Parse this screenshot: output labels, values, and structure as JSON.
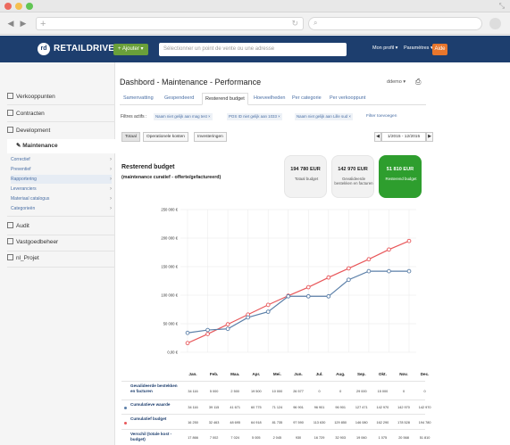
{
  "browser": {
    "add_tab": "+",
    "back": "◀",
    "forward": "▶",
    "reload": "↻",
    "search": "⌕"
  },
  "header": {
    "logo_text": "RETAILDRIVE",
    "logo_mark": "rd",
    "add_button": "+ Ajouter ▾",
    "select_placeholder": "Sélectionner un point de vente ou une adresse",
    "profile_menu": "Mon profil ▾",
    "settings_menu": "Paramètres ▾",
    "help_button": "Aide",
    "brand_color": "#1d3e6e",
    "add_color": "#6aa03a",
    "help_color": "#e8762c"
  },
  "sidebar": {
    "items": [
      {
        "label": "Verkooppunten",
        "icon": "store-icon"
      },
      {
        "label": "Contracten",
        "icon": "contract-icon"
      },
      {
        "label": "Development",
        "icon": "development-icon"
      },
      {
        "label": "Maintenance",
        "icon": "wrench-icon"
      },
      {
        "label": "Audit",
        "icon": "audit-icon"
      },
      {
        "label": "Vastgoedbeheer",
        "icon": "building-icon"
      },
      {
        "label": "nl_Projet",
        "icon": "project-icon"
      }
    ],
    "sub_items": [
      "Correctief",
      "Preventief",
      "Rapportering",
      "Leveranciers",
      "Materiaal catalogus",
      "Categorieën"
    ]
  },
  "main": {
    "title": "Dashbord - Maintenance - Performance",
    "user_menu": "ddemo ▾",
    "print_icon": "⎙",
    "tabs": [
      "Samenvatting",
      "Gespendeerd",
      "Resterend budget",
      "Hoeveelheden",
      "Per categorie",
      "Per verkooppunt"
    ],
    "filters_label": "Filtres actifs :",
    "filters": [
      "Naam niet gelijk aan mag test ×",
      "POS ID niet gelijk aan 1033 ×",
      "Naam niet gelijk aan Lille sud ×"
    ],
    "filter_add": "Filter toevoegen",
    "segments": [
      "Totaal",
      "Operationele kosten",
      "Investeringen"
    ],
    "period": "1/2015 - 12/2015",
    "period_prev": "◀",
    "period_next": "▶",
    "section_title": "Resterend budget",
    "section_sub": "(maintenance curatief - offerte/gefactureerd)",
    "kpis": [
      {
        "value": "194 780 EUR",
        "label": "Totaal budget"
      },
      {
        "value": "142 970 EUR",
        "label": "Gevalideerde bestekken en facturen"
      },
      {
        "value": "51 810 EUR",
        "label": "Resterend budget"
      }
    ]
  },
  "chart_data": {
    "type": "line",
    "title": "",
    "ylim": [
      0,
      250000
    ],
    "yticks": [
      "0,00 €",
      "50 000 €",
      "100 000 €",
      "150 000 €",
      "200 000 €",
      "250 000 €"
    ],
    "categories": [
      "Jan.",
      "Feb.",
      "Maa.",
      "Apr.",
      "Mei.",
      "Jun.",
      "Jul.",
      "Aug.",
      "Sep.",
      "Okt.",
      "Nov.",
      "Dec."
    ],
    "series": [
      {
        "name": "Cumulatief budget",
        "color": "#e8575a",
        "values": [
          16000,
          32000,
          49000,
          66000,
          83000,
          99000,
          114000,
          131000,
          147000,
          163000,
          180000,
          195000
        ]
      },
      {
        "name": "Cumulatieve waarde",
        "color": "#5b7fa8",
        "values": [
          34000,
          39000,
          41000,
          61000,
          71000,
          98000,
          98000,
          98000,
          127000,
          142000,
          142000,
          142000
        ]
      }
    ],
    "grid": true
  },
  "table": {
    "rows": [
      {
        "label": "Gevalideerde bestekken en facturen",
        "dot": "",
        "values": [
          "34 116",
          "5 000",
          "2 500",
          "19 500",
          "10 000",
          "26 577",
          "0",
          "0",
          "29 000",
          "15 000",
          "0",
          "0"
        ]
      },
      {
        "label": "Cumulatieve waarde",
        "dot": "#5b7fa8",
        "values": [
          "34 116",
          "39 115",
          "41 671",
          "60 775",
          "71 124",
          "96 901",
          "96 901",
          "96 901",
          "127 471",
          "142 970",
          "142 970",
          "142 970"
        ]
      },
      {
        "label": "Cumulatief budget",
        "dot": "#e8575a",
        "values": [
          "16 250",
          "32 463",
          "48 695",
          "64 918",
          "81 735",
          "97 590",
          "113 630",
          "129 850",
          "146 080",
          "162 290",
          "178 528",
          "194 780"
        ]
      },
      {
        "label": "Verschil (totale kost - budget)",
        "dot": "",
        "values": [
          "17 866",
          "7 002",
          "7 024",
          "5 005",
          "2 045",
          "930",
          "16 729",
          "32 903",
          "19 060",
          "1 075",
          "20 568",
          "51 810"
        ]
      }
    ]
  }
}
